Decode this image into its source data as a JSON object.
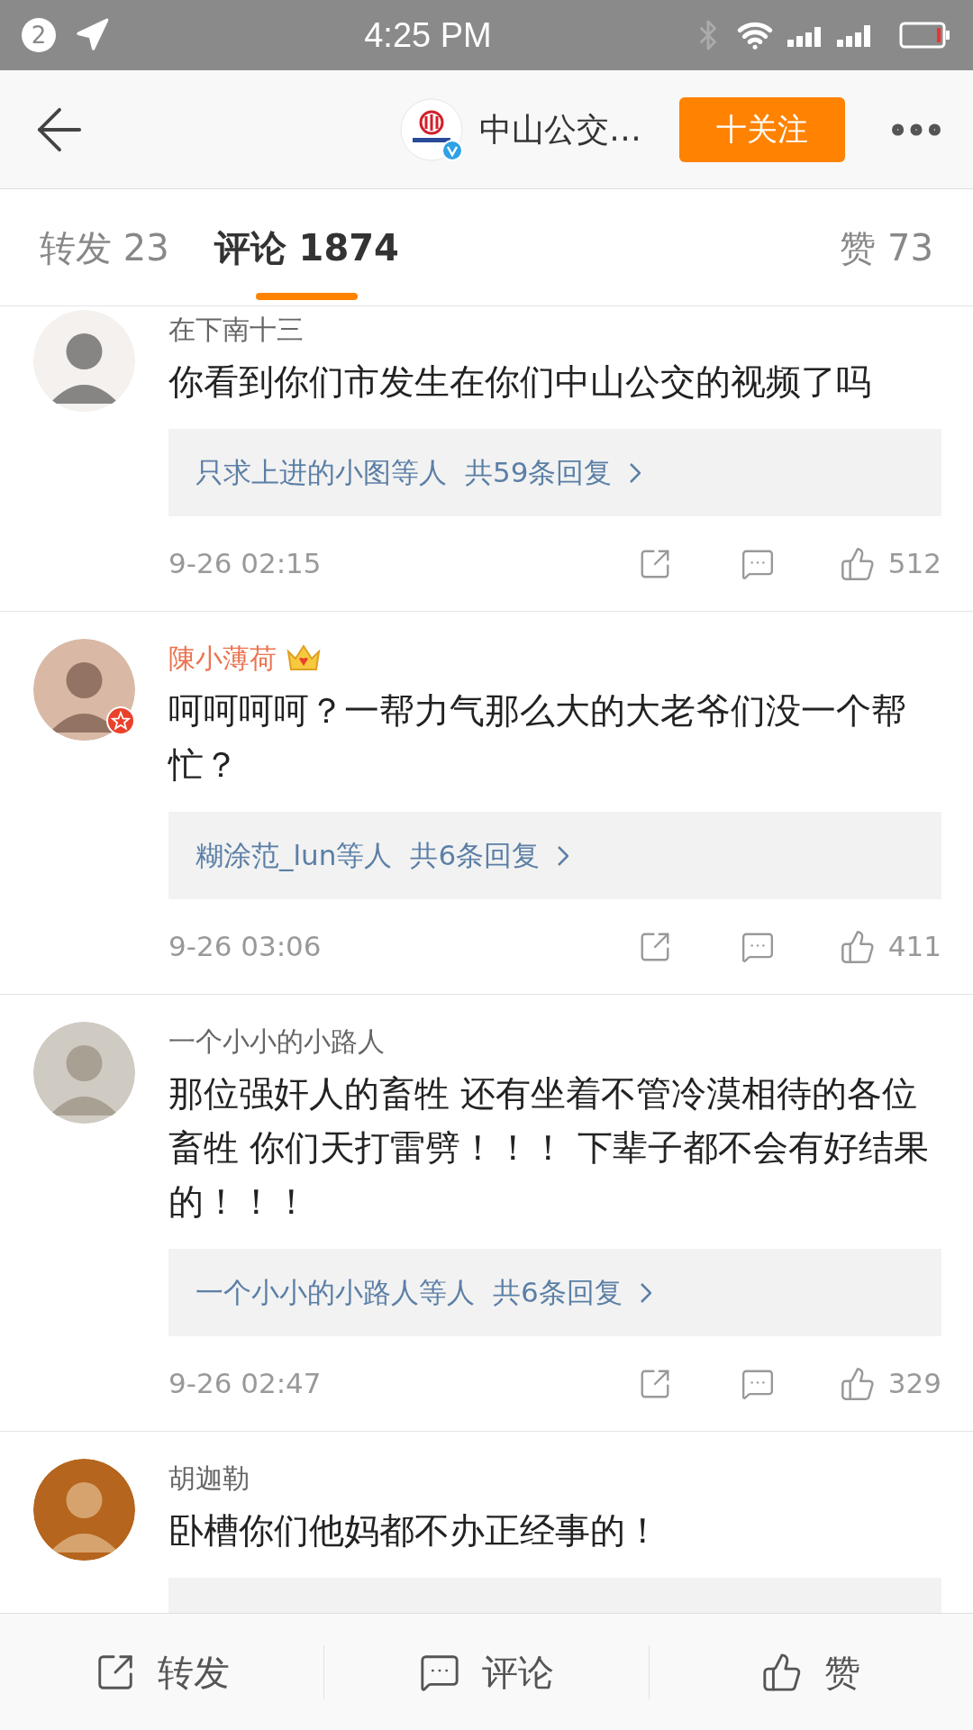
{
  "status_bar": {
    "notification_count": "2",
    "time": "4:25 PM"
  },
  "header": {
    "account_name": "中山公交…",
    "verified": true,
    "follow_button": "十关注"
  },
  "tabs": [
    {
      "label": "转发",
      "count": "23",
      "selected": false
    },
    {
      "label": "评论",
      "count": "1874",
      "selected": true
    },
    {
      "label": "赞",
      "count": "73",
      "selected": false
    }
  ],
  "comments": [
    {
      "name": "在下南十三",
      "vip": false,
      "text": "你看到你们市发生在你们中山公交的视频了吗",
      "replies": {
        "names": "只求上进的小图等人",
        "count": "共59条回复"
      },
      "time": "9-26 02:15",
      "likes": "512"
    },
    {
      "name": "陳小薄荷",
      "vip": true,
      "text": "呵呵呵呵？一帮力气那么大的大老爷们没一个帮忙？",
      "replies": {
        "names": "糊涂范_lun等人",
        "count": "共6条回复"
      },
      "time": "9-26 03:06",
      "likes": "411"
    },
    {
      "name": "一个小小的小路人",
      "vip": false,
      "text": "那位强奸人的畜牲 还有坐着不管冷漠相待的各位畜牲  你们天打雷劈！！！ 下辈子都不会有好结果的！！！",
      "replies": {
        "names": "一个小小的小路人等人",
        "count": "共6条回复"
      },
      "time": "9-26 02:47",
      "likes": "329"
    },
    {
      "name": "胡迦勒",
      "vip": false,
      "text": "卧槽你们他妈都不办正经事的！",
      "kind": "cut_off"
    }
  ],
  "bottom_bar": [
    {
      "kind": "repost",
      "label": "转发"
    },
    {
      "kind": "comment",
      "label": "评论"
    },
    {
      "kind": "like",
      "label": "赞"
    }
  ]
}
